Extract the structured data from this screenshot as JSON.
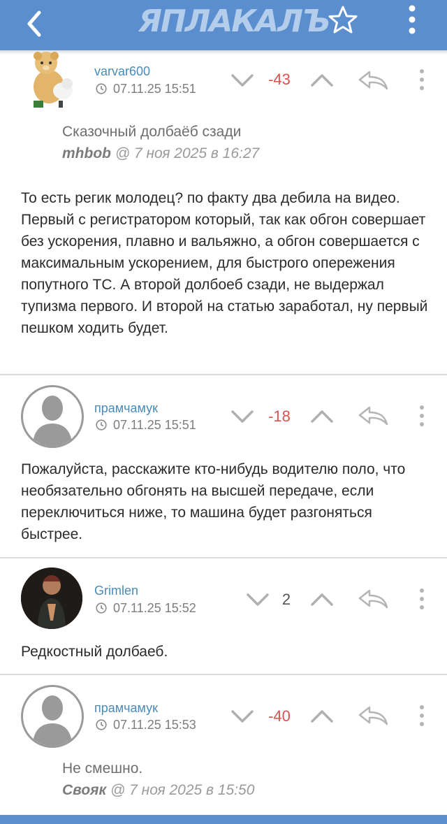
{
  "header": {
    "logo_text": "ЯПЛАКАЛЪ",
    "back_icon": "chevron-left-icon",
    "favorite_icon": "star-icon",
    "menu_icon": "more-vertical-icon",
    "background": "#5b8ecf"
  },
  "comments": [
    {
      "username": "varvar600",
      "time": "07.11.25 15:51",
      "score": "-43",
      "avatar": "teddy-bear-avatar",
      "quote": {
        "text": "Сказочный долбаёб сзади",
        "author": "mhbob",
        "meta": " @ 7 ноя 2025 в 16:27"
      },
      "body": "То есть регик молодец? по факту два дебила на видео. Первый с регистратором который, так как обгон совершает без ускорения, плавно и вальяжно, а обгон совершается с максимальным ускорением, для быстрого опережения попутного ТС. А второй долбоеб сзади, не выдержал тупизма первого. И второй на статью заработал, ну первый пешком ходить будет."
    },
    {
      "username": "прамчамук",
      "time": "07.11.25 15:51",
      "score": "-18",
      "avatar": "default-user-avatar",
      "body": "Пожалуйста, расскажите кто-нибудь водителю поло, что необязательно обгонять на высшей передаче, если переключиться ниже, то машина будет разгоняться быстрее."
    },
    {
      "username": "Grimlen",
      "time": "07.11.25 15:52",
      "score": "2",
      "avatar": "photo-avatar",
      "body": "Редкостный долбаеб."
    },
    {
      "username": "прамчамук",
      "time": "07.11.25 15:53",
      "score": "-40",
      "avatar": "default-user-avatar",
      "quote": {
        "text": "Не смешно.",
        "author": "Свояк",
        "meta": " @ 7 ноя 2025 в 15:50"
      }
    }
  ],
  "colors": {
    "negative_score": "#d9534f",
    "username": "#4a8bb8"
  }
}
